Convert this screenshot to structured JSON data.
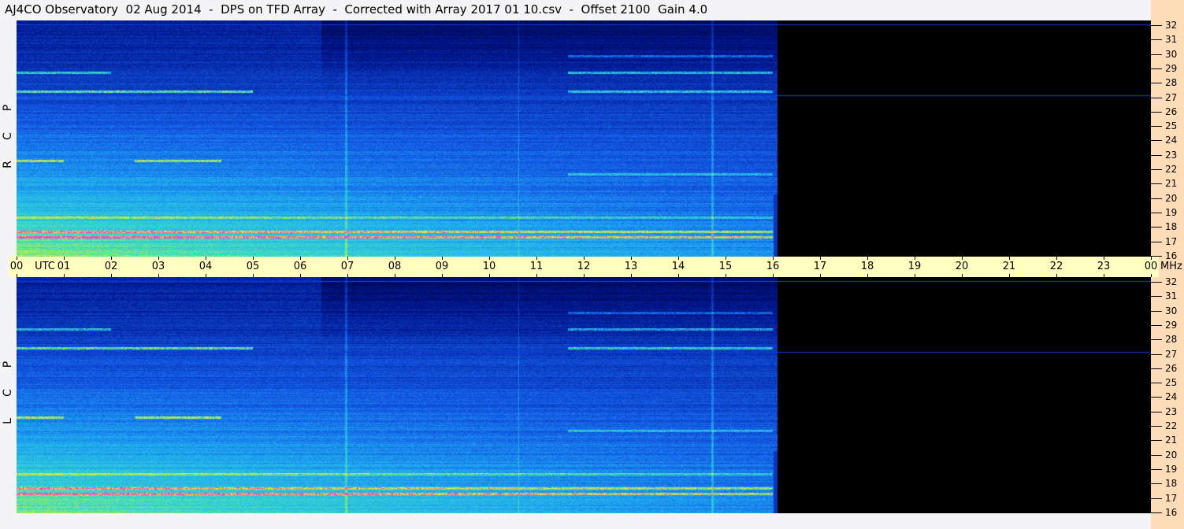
{
  "title": "AJ4CO Observatory  02 Aug 2014  -  DPS on TFD Array  -  Corrected with Array 2017 01 10.csv  -  Offset 2100  Gain 4.0",
  "panels": [
    {
      "label": [
        "R",
        "C",
        "P"
      ]
    },
    {
      "label": [
        "L",
        "C",
        "P"
      ]
    }
  ],
  "time_axis": {
    "labels": [
      "00",
      "01",
      "02",
      "03",
      "04",
      "05",
      "06",
      "07",
      "08",
      "09",
      "10",
      "11",
      "12",
      "13",
      "14",
      "15",
      "16",
      "17",
      "18",
      "19",
      "20",
      "21",
      "22",
      "23",
      "00"
    ],
    "utc_label": "UTC",
    "unit": "MHz"
  },
  "freq_axis": {
    "labels": [
      "32",
      "31",
      "30",
      "29",
      "28",
      "27",
      "26",
      "25",
      "24",
      "23",
      "22",
      "21",
      "20",
      "19",
      "18",
      "17",
      "16"
    ]
  },
  "data_end_hour": 16.1
}
